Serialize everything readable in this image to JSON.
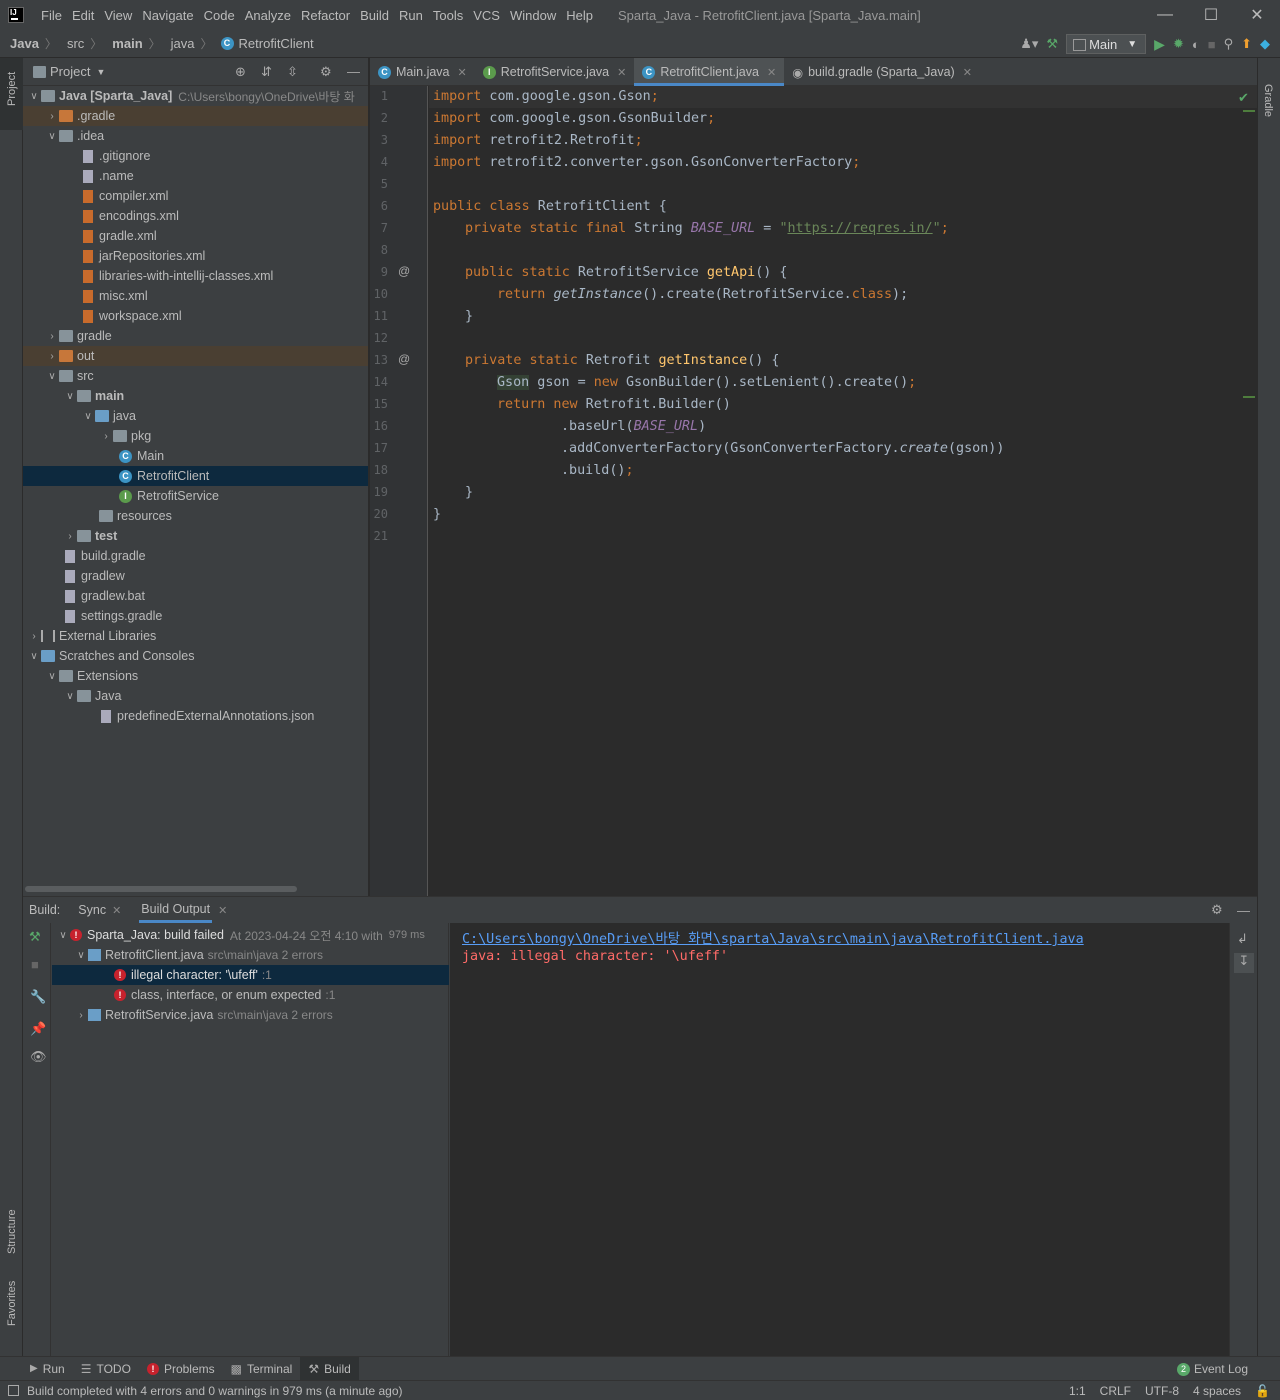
{
  "titlebar": {
    "menus": [
      "File",
      "Edit",
      "View",
      "Navigate",
      "Code",
      "Analyze",
      "Refactor",
      "Build",
      "Run",
      "Tools",
      "VCS",
      "Window",
      "Help"
    ],
    "title": "Sparta_Java - RetrofitClient.java [Sparta_Java.main]"
  },
  "navbar": {
    "crumbs": [
      "Java",
      "src",
      "main",
      "java",
      "RetrofitClient"
    ],
    "run_config": "Main"
  },
  "left_strip": {
    "project": "Project",
    "structure": "Structure",
    "favorites": "Favorites"
  },
  "right_strip": {
    "gradle": "Gradle"
  },
  "project": {
    "header": "Project",
    "root_name": "Java [Sparta_Java]",
    "root_path": "C:\\Users\\bongy\\OneDrive\\바탕 화",
    "items": [
      {
        "label": ".gradle"
      },
      {
        "label": ".idea"
      },
      {
        "label": ".gitignore"
      },
      {
        "label": ".name"
      },
      {
        "label": "compiler.xml"
      },
      {
        "label": "encodings.xml"
      },
      {
        "label": "gradle.xml"
      },
      {
        "label": "jarRepositories.xml"
      },
      {
        "label": "libraries-with-intellij-classes.xml"
      },
      {
        "label": "misc.xml"
      },
      {
        "label": "workspace.xml"
      },
      {
        "label": "gradle"
      },
      {
        "label": "out"
      },
      {
        "label": "src"
      },
      {
        "label": "main"
      },
      {
        "label": "java"
      },
      {
        "label": "pkg"
      },
      {
        "label": "Main"
      },
      {
        "label": "RetrofitClient"
      },
      {
        "label": "RetrofitService"
      },
      {
        "label": "resources"
      },
      {
        "label": "test"
      },
      {
        "label": "build.gradle"
      },
      {
        "label": "gradlew"
      },
      {
        "label": "gradlew.bat"
      },
      {
        "label": "settings.gradle"
      },
      {
        "label": "External Libraries"
      },
      {
        "label": "Scratches and Consoles"
      },
      {
        "label": "Extensions"
      },
      {
        "label": "Java"
      },
      {
        "label": "predefinedExternalAnnotations.json"
      }
    ]
  },
  "editor": {
    "tabs": [
      "Main.java",
      "RetrofitService.java",
      "RetrofitClient.java",
      "build.gradle (Sparta_Java)"
    ],
    "line_numbers": [
      "1",
      "2",
      "3",
      "4",
      "5",
      "6",
      "7",
      "8",
      "9",
      "10",
      "11",
      "12",
      "13",
      "14",
      "15",
      "16",
      "17",
      "18",
      "19",
      "20",
      "21"
    ],
    "code": {
      "l1a": "import",
      "l1b": " com.google.gson.Gson",
      "l1c": ";",
      "l2a": "import",
      "l2b": " com.google.gson.GsonBuilder",
      "l2c": ";",
      "l3a": "import",
      "l3b": " retrofit2.Retrofit",
      "l3c": ";",
      "l4a": "import",
      "l4b": " retrofit2.converter.gson.GsonConverterFactory",
      "l4c": ";",
      "l6a": "public class",
      "l6b": " RetrofitClient {",
      "l7a": "private static final",
      "l7b": " String ",
      "l7c": "BASE_URL",
      "l7d": " = ",
      "l7e": "\"",
      "l7f": "https://reqres.in/",
      "l7g": "\"",
      "l7h": ";",
      "l9a": "public static",
      "l9b": " RetrofitService ",
      "l9c": "getApi",
      "l9d": "() {",
      "l10a": "return",
      "l10b": " ",
      "l10c": "getInstance",
      "l10d": "().create(RetrofitService.",
      "l10e": "class",
      "l10f": ");",
      "l11": "}",
      "l13a": "private static",
      "l13b": " Retrofit ",
      "l13c": "getInstance",
      "l13d": "() {",
      "l14a": "Gson",
      "l14b": " gson = ",
      "l14c": "new",
      "l14d": " GsonBuilder().setLenient().create()",
      "l14e": ";",
      "l15a": "return new",
      "l15b": " Retrofit.Builder()",
      "l16a": ".baseUrl(",
      "l16b": "BASE_URL",
      "l16c": ")",
      "l17a": ".addConverterFactory(GsonConverterFactory.",
      "l17b": "create",
      "l17c": "(gson))",
      "l18a": ".build()",
      "l18b": ";",
      "l19": "}",
      "l20": "}"
    }
  },
  "build": {
    "tabs": [
      "Build:",
      "Sync",
      "Build Output"
    ],
    "root_label": "Sparta_Java: build failed",
    "root_meta": "At 2023-04-24 오전 4:10 with",
    "root_time": "979 ms",
    "file1": "RetrofitClient.java",
    "file1_meta": "src\\main\\java 2 errors",
    "err1": "illegal character: '\\ufeff'",
    "err1_loc": ":1",
    "err2": "class, interface, or enum expected",
    "err2_loc": ":1",
    "file2": "RetrofitService.java",
    "file2_meta": "src\\main\\java 2 errors",
    "output_path": "C:\\Users\\bongy\\OneDrive\\바탕 화면\\sparta\\Java\\src\\main\\java\\RetrofitClient.java",
    "output_error": "java: illegal character: '\\ufeff'"
  },
  "bottom_tabs": [
    "Run",
    "TODO",
    "Problems",
    "Terminal",
    "Build"
  ],
  "event_log": {
    "count": "2",
    "label": "Event Log"
  },
  "status": {
    "message": "Build completed with 4 errors and 0 warnings in 979 ms (a minute ago)",
    "position": "1:1",
    "line_sep": "CRLF",
    "encoding": "UTF-8",
    "indent": "4 spaces"
  }
}
